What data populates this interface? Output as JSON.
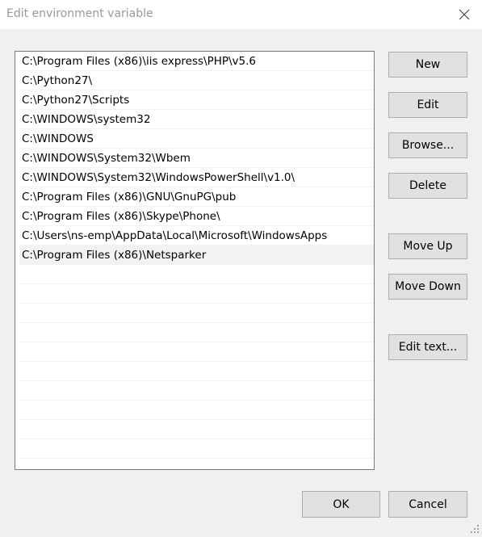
{
  "window": {
    "title": "Edit environment variable",
    "close_icon": "close-icon"
  },
  "list": {
    "items": [
      "C:\\Program Files (x86)\\iis express\\PHP\\v5.6",
      "C:\\Python27\\",
      "C:\\Python27\\Scripts",
      "C:\\WINDOWS\\system32",
      "C:\\WINDOWS",
      "C:\\WINDOWS\\System32\\Wbem",
      "C:\\WINDOWS\\System32\\WindowsPowerShell\\v1.0\\",
      "C:\\Program Files (x86)\\GNU\\GnuPG\\pub",
      "C:\\Program Files (x86)\\Skype\\Phone\\",
      "C:\\Users\\ns-emp\\AppData\\Local\\Microsoft\\WindowsApps",
      "C:\\Program Files (x86)\\Netsparker"
    ],
    "selected_index": 10,
    "empty_rows": 10
  },
  "buttons": {
    "new": "New",
    "edit": "Edit",
    "browse": "Browse...",
    "delete": "Delete",
    "move_up": "Move Up",
    "move_down": "Move Down",
    "edit_text": "Edit text...",
    "ok": "OK",
    "cancel": "Cancel"
  },
  "colors": {
    "dialog_bg": "#f0f0f0",
    "button_bg": "#e1e1e1",
    "button_border": "#adadad",
    "selected_row_bg": "#f2f2f2",
    "title_text": "#999999"
  }
}
